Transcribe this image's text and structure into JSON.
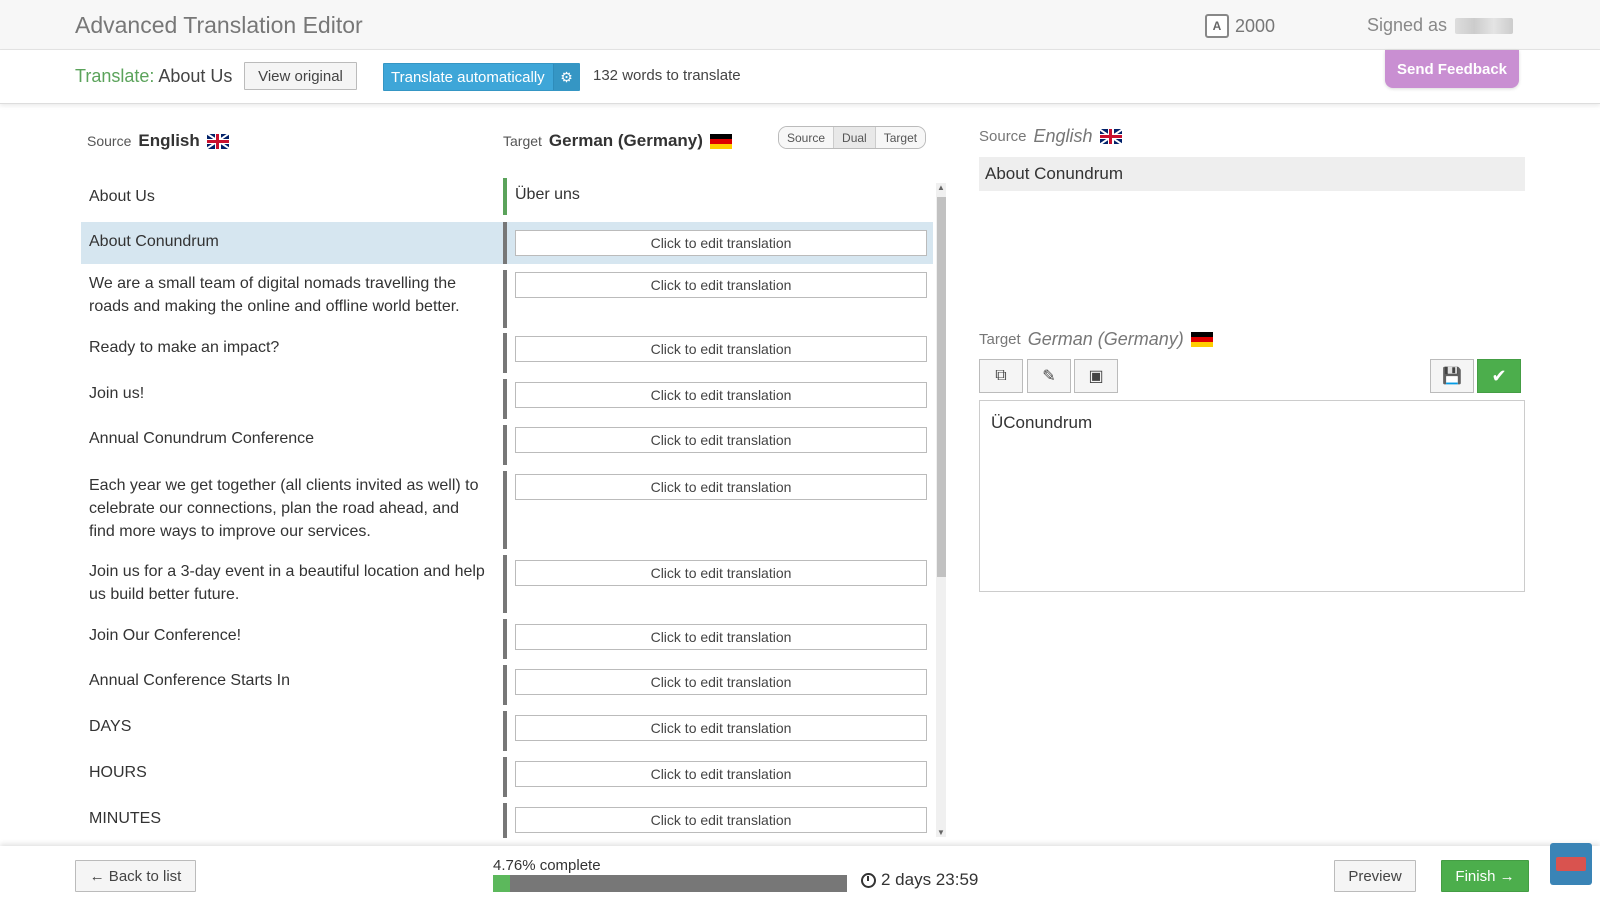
{
  "header": {
    "title": "Advanced Translation Editor",
    "credits": "2000",
    "signed_as_label": "Signed as"
  },
  "toolbar": {
    "translate_prefix": "Translate:",
    "page_name": "About Us",
    "view_original": "View original",
    "translate_auto": "Translate automatically",
    "words_to_translate": "132 words to translate",
    "send_feedback": "Send Feedback"
  },
  "columns": {
    "source_label": "Source",
    "source_lang": "English",
    "target_label": "Target",
    "target_lang": "German (Germany)",
    "view_modes": [
      "Source",
      "Dual",
      "Target"
    ],
    "active_view": "Dual"
  },
  "edit_placeholder": "Click to edit translation",
  "rows": [
    {
      "source": "About Us",
      "target": "Über uns"
    },
    {
      "source": "About Conundrum",
      "target": ""
    },
    {
      "source": "We are a small team of digital nomads travelling the roads and making the online and offline world better.",
      "target": ""
    },
    {
      "source": "Ready to make an impact?",
      "target": ""
    },
    {
      "source": "Join us!",
      "target": ""
    },
    {
      "source": "Annual Conundrum Conference",
      "target": ""
    },
    {
      "source": "Each year we get together (all clients invited as well) to celebrate our connections, plan the road ahead, and find more ways to improve our services.",
      "target": ""
    },
    {
      "source": "Join us for a 3-day event in a beautiful location and help us build better future.",
      "target": ""
    },
    {
      "source": "Join Our Conference!",
      "target": ""
    },
    {
      "source": "Annual Conference Starts In",
      "target": ""
    },
    {
      "source": "DAYS",
      "target": ""
    },
    {
      "source": "HOURS",
      "target": ""
    },
    {
      "source": "MINUTES",
      "target": ""
    }
  ],
  "right_panel": {
    "source_label": "Source",
    "source_lang": "English",
    "source_text": "About Conundrum",
    "target_label": "Target",
    "target_lang": "German (Germany)",
    "target_text": "ÜConundrum"
  },
  "footer": {
    "back": "← Back to list",
    "progress_text": "4.76% complete",
    "progress_value": 4.76,
    "timer": "2 days 23:59",
    "preview": "Preview",
    "finish": "Finish →"
  },
  "colors": {
    "accent_blue": "#3ea6d8",
    "green": "#4cae4c",
    "feedback": "#c98fd2",
    "selected_row": "#d6e6f0"
  }
}
